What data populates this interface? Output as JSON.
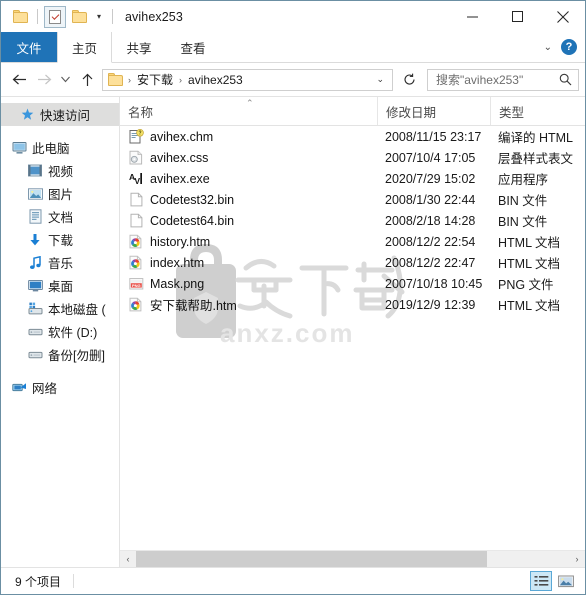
{
  "window": {
    "title": "avihex253",
    "quick_access_toolbar": [
      {
        "name": "folder-icon",
        "label": "folder"
      },
      {
        "name": "properties-icon",
        "label": "properties"
      },
      {
        "name": "new-folder-icon",
        "label": "new folder"
      }
    ],
    "controls": {
      "minimize": "minimize",
      "maximize": "maximize",
      "close": "close"
    }
  },
  "ribbon": {
    "tabs": [
      {
        "label": "文件",
        "state": "file"
      },
      {
        "label": "主页",
        "state": "active"
      },
      {
        "label": "共享",
        "state": "normal"
      },
      {
        "label": "查看",
        "state": "normal"
      }
    ],
    "expand_label": "展开功能区",
    "help_label": "?"
  },
  "address": {
    "back": "后退",
    "forward": "前进",
    "recent": "最近浏览的位置",
    "up": "上移到",
    "breadcrumbs": [
      "安下载",
      "avihex253"
    ],
    "separator": "›",
    "dropdown": "历史记录",
    "refresh": "刷新",
    "search": {
      "placeholder": "搜索\"avihex253\"",
      "value": ""
    }
  },
  "sidebar": {
    "items": [
      {
        "label": "快速访问",
        "icon": "pin-star-icon",
        "indent": 0,
        "selected": true
      },
      {
        "label": "此电脑",
        "icon": "this-pc-icon",
        "indent": 1,
        "selected": false,
        "gap_before": true
      },
      {
        "label": "视频",
        "icon": "videos-icon",
        "indent": 2,
        "selected": false
      },
      {
        "label": "图片",
        "icon": "pictures-icon",
        "indent": 2,
        "selected": false
      },
      {
        "label": "文档",
        "icon": "documents-icon",
        "indent": 2,
        "selected": false
      },
      {
        "label": "下载",
        "icon": "downloads-icon",
        "indent": 2,
        "selected": false
      },
      {
        "label": "音乐",
        "icon": "music-icon",
        "indent": 2,
        "selected": false
      },
      {
        "label": "桌面",
        "icon": "desktop-icon",
        "indent": 2,
        "selected": false
      },
      {
        "label": "本地磁盘 (",
        "icon": "system-drive-icon",
        "indent": 2,
        "selected": false
      },
      {
        "label": "软件 (D:)",
        "icon": "drive-icon",
        "indent": 2,
        "selected": false
      },
      {
        "label": "备份[勿删]",
        "icon": "drive-icon",
        "indent": 2,
        "selected": false
      },
      {
        "label": "网络",
        "icon": "network-icon",
        "indent": 1,
        "selected": false,
        "gap_before": true
      }
    ]
  },
  "filelist": {
    "columns": [
      {
        "label": "名称",
        "sorted": "asc"
      },
      {
        "label": "修改日期",
        "sorted": ""
      },
      {
        "label": "类型",
        "sorted": ""
      }
    ],
    "sort_caret": "⌃",
    "rows": [
      {
        "name": "avihex.chm",
        "date": "2008/11/15 23:17",
        "type": "编译的 HTML",
        "icon": "chm-help-icon"
      },
      {
        "name": "avihex.css",
        "date": "2007/10/4 17:05",
        "type": "层叠样式表文",
        "icon": "css-file-icon"
      },
      {
        "name": "avihex.exe",
        "date": "2020/7/29 15:02",
        "type": "应用程序",
        "icon": "exe-app-icon"
      },
      {
        "name": "Codetest32.bin",
        "date": "2008/1/30 22:44",
        "type": "BIN 文件",
        "icon": "generic-file-icon"
      },
      {
        "name": "Codetest64.bin",
        "date": "2008/2/18 14:28",
        "type": "BIN 文件",
        "icon": "generic-file-icon"
      },
      {
        "name": "history.htm",
        "date": "2008/12/2 22:54",
        "type": "HTML 文档",
        "icon": "html-file-icon"
      },
      {
        "name": "index.htm",
        "date": "2008/12/2 22:47",
        "type": "HTML 文档",
        "icon": "html-file-icon"
      },
      {
        "name": "Mask.png",
        "date": "2007/10/18 10:45",
        "type": "PNG 文件",
        "icon": "png-file-icon"
      },
      {
        "name": "安下载帮助.htm",
        "date": "2019/12/9 12:39",
        "type": "HTML 文档",
        "icon": "html-file-icon"
      }
    ]
  },
  "watermark": {
    "text": "安下载",
    "site": "anxz.com"
  },
  "scrollbar": {
    "left_arrow": "‹",
    "right_arrow": "›"
  },
  "statusbar": {
    "item_count": "9 个项目",
    "views": [
      {
        "name": "details-view-button",
        "label": "详细信息",
        "active": true
      },
      {
        "name": "large-icons-view-button",
        "label": "大图标",
        "active": false
      }
    ]
  },
  "colors": {
    "accent": "#1f73b7",
    "selection": "#cde8f6",
    "border": "#6b8fa3"
  }
}
